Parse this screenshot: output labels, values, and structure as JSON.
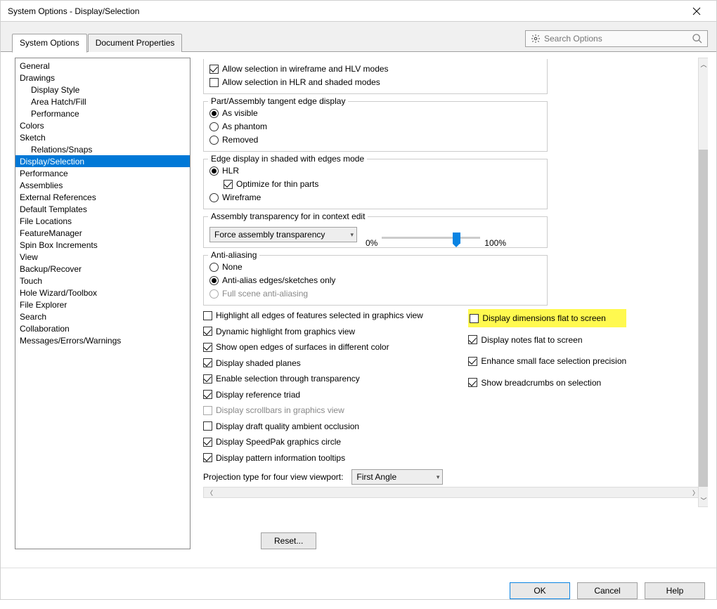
{
  "window": {
    "title": "System Options - Display/Selection"
  },
  "tabs": {
    "system_options": "System Options",
    "document_properties": "Document Properties"
  },
  "search": {
    "placeholder": "Search Options"
  },
  "sidebar": {
    "items": [
      {
        "label": "General",
        "child": false
      },
      {
        "label": "Drawings",
        "child": false
      },
      {
        "label": "Display Style",
        "child": true
      },
      {
        "label": "Area Hatch/Fill",
        "child": true
      },
      {
        "label": "Performance",
        "child": true
      },
      {
        "label": "Colors",
        "child": false
      },
      {
        "label": "Sketch",
        "child": false
      },
      {
        "label": "Relations/Snaps",
        "child": true
      },
      {
        "label": "Display/Selection",
        "child": false,
        "selected": true
      },
      {
        "label": "Performance",
        "child": false
      },
      {
        "label": "Assemblies",
        "child": false
      },
      {
        "label": "External References",
        "child": false
      },
      {
        "label": "Default Templates",
        "child": false
      },
      {
        "label": "File Locations",
        "child": false
      },
      {
        "label": "FeatureManager",
        "child": false
      },
      {
        "label": "Spin Box Increments",
        "child": false
      },
      {
        "label": "View",
        "child": false
      },
      {
        "label": "Backup/Recover",
        "child": false
      },
      {
        "label": "Touch",
        "child": false
      },
      {
        "label": "Hole Wizard/Toolbox",
        "child": false
      },
      {
        "label": "File Explorer",
        "child": false
      },
      {
        "label": "Search",
        "child": false
      },
      {
        "label": "Collaboration",
        "child": false
      },
      {
        "label": "Messages/Errors/Warnings",
        "child": false
      }
    ]
  },
  "groups": {
    "top": {
      "allow_wireframe_hlv": "Allow selection in wireframe and HLV modes",
      "allow_hlr_shaded": "Allow selection in HLR and shaded modes"
    },
    "tangent": {
      "legend": "Part/Assembly tangent edge display",
      "as_visible": "As visible",
      "as_phantom": "As phantom",
      "removed": "Removed"
    },
    "edge_shaded": {
      "legend": "Edge display in shaded with edges mode",
      "hlr": "HLR",
      "optimize_thin": "Optimize for thin parts",
      "wireframe": "Wireframe"
    },
    "assembly_trans": {
      "legend": "Assembly transparency for in context edit",
      "dropdown_value": "Force assembly transparency",
      "pct0": "0%",
      "pct100": "100%"
    },
    "antialias": {
      "legend": "Anti-aliasing",
      "none": "None",
      "edges_sketches": "Anti-alias edges/sketches only",
      "full_scene": "Full scene anti-aliasing"
    }
  },
  "left_options": {
    "highlight_all_edges": "Highlight all edges of features selected in graphics view",
    "dynamic_highlight": "Dynamic highlight from graphics view",
    "show_open_edges": "Show open edges of surfaces in different color",
    "display_shaded_planes": "Display shaded planes",
    "enable_sel_trans": "Enable selection through transparency",
    "display_ref_triad": "Display reference triad",
    "display_scrollbars": "Display scrollbars in graphics view",
    "display_draft_ao": "Display draft quality ambient occlusion",
    "display_speedpak": "Display SpeedPak graphics circle",
    "display_pattern_tooltips": "Display pattern information tooltips"
  },
  "right_options": {
    "dims_flat": "Display dimensions flat to screen",
    "notes_flat": "Display notes flat to screen",
    "enhance_small_face": "Enhance small face selection precision",
    "show_breadcrumbs": "Show breadcrumbs on selection"
  },
  "projection": {
    "label": "Projection type for four view viewport:",
    "value": "First Angle"
  },
  "buttons": {
    "reset": "Reset...",
    "ok": "OK",
    "cancel": "Cancel",
    "help": "Help"
  }
}
